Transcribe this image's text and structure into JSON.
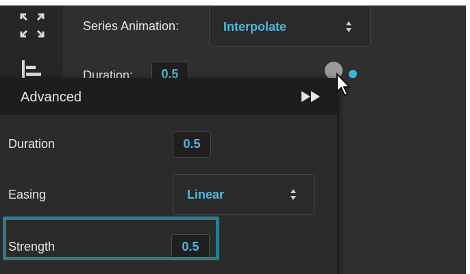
{
  "series_animation": {
    "label": "Series Animation:",
    "value": "Interpolate"
  },
  "background_duration": {
    "label": "Duration:",
    "value": "0.5"
  },
  "advanced_panel": {
    "title": "Advanced",
    "duration": {
      "label": "Duration",
      "value": "0.5"
    },
    "easing": {
      "label": "Easing",
      "value": "Linear"
    },
    "strength": {
      "label": "Strength",
      "value": "0.5"
    }
  },
  "icons": {
    "sidebar_top": "expand-arrows-icon",
    "sidebar_second": "align-bars-icon",
    "info": "info-icon",
    "panel_expand": "fast-forward-icon",
    "cursor": "pointer-cursor-icon"
  },
  "colors": {
    "accent": "#4fb8dc",
    "dot": "#3fb4e0",
    "highlight": "#2b7d8f",
    "panel_bg": "#2b2b2b",
    "panel_header": "#1d1d1d"
  }
}
